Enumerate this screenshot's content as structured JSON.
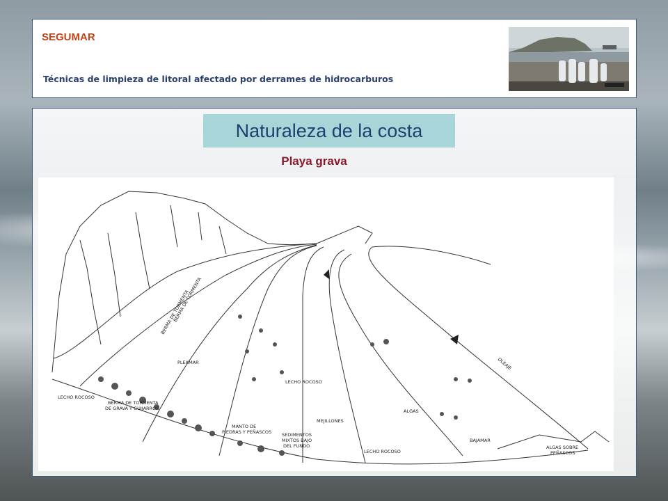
{
  "header": {
    "brand": "SEGUMAR",
    "subtitle": "Técnicas de limpieza de litoral afectado por derrames de hidrocarburos"
  },
  "main": {
    "section_title": "Naturaleza de la costa",
    "subsection_title": "Playa grava"
  },
  "illustration": {
    "labels": {
      "lecho_rocoso_left": "LECHO ROCOSO",
      "berma_tormenta_1": "BERMA DE TORMENTA",
      "berma_tormenta_2": "DE GRAVA Y GUIJARROS",
      "pleamar": "PLEAMAR",
      "lecho_rocoso_mid": "LECHO ROCOSO",
      "manto_1": "MANTO DE",
      "manto_2": "PIEDRAS Y PEÑASCOS",
      "sedimentos_1": "SEDIMENTOS",
      "sedimentos_2": "MIXTOS BAJO",
      "sedimentos_3": "DEL FUNDO",
      "mejillones": "MEJILLONES",
      "algas": "ALGAS",
      "lecho_rocoso_bottom": "LECHO ROCOSO",
      "bajamar": "BAJAMAR",
      "algas_penascos_1": "ALGAS SOBRE",
      "algas_penascos_2": "PEÑASCOS",
      "oleaje": "OLEAJE",
      "berma_vertical_1": "BERMA DE TORMENTA",
      "berma_vertical_2": "BERMA DE TORMENTA"
    }
  },
  "colors": {
    "brand": "#c0441a",
    "subtitle": "#2a3f6a",
    "section_bg": "#a8d6d8",
    "section_text": "#1f3f6f",
    "subsection_text": "#8a1a2a",
    "panel_border": "#3a5a7a"
  }
}
